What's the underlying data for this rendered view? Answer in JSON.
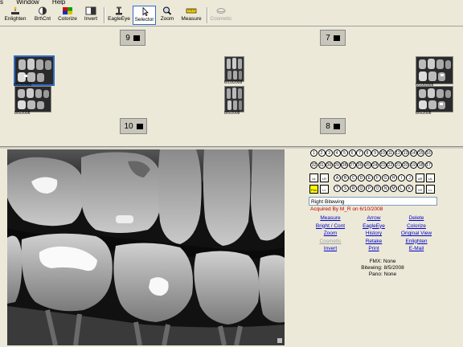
{
  "menubar": {
    "items": [
      "s",
      "Window",
      "Help"
    ]
  },
  "toolbar": {
    "buttons": [
      {
        "label": "Enlighten",
        "icon": "enlighten-icon",
        "selected": false,
        "disabled": false
      },
      {
        "label": "Brt\\Cnt",
        "icon": "brightness-contrast-icon",
        "selected": false,
        "disabled": false
      },
      {
        "label": "Colorize",
        "icon": "colorize-icon",
        "selected": false,
        "disabled": false
      },
      {
        "label": "Invert",
        "icon": "invert-icon",
        "selected": false,
        "disabled": false
      },
      {
        "label": "EagleEye",
        "icon": "eagleeye-icon",
        "selected": false,
        "disabled": false
      },
      {
        "label": "Selector",
        "icon": "selector-arrow-icon",
        "selected": true,
        "disabled": false
      },
      {
        "label": "Zoom",
        "icon": "zoom-icon",
        "selected": false,
        "disabled": false
      },
      {
        "label": "Measure",
        "icon": "measure-icon",
        "selected": false,
        "disabled": false
      },
      {
        "label": "Cosmetic",
        "icon": "cosmetic-icon",
        "selected": false,
        "disabled": true
      }
    ]
  },
  "nav": {
    "top_left": "9",
    "top_right": "7",
    "bottom_left": "10",
    "bottom_right": "8"
  },
  "thumbnails": {
    "left_top_date": "6/10/2008",
    "left_bottom_date": "8/5/2008",
    "mid_top_date": "6/10/2008",
    "mid_bottom_date": "8/5/2008",
    "right_top_date": "6/10/2008",
    "right_bottom_date": "8/5/2008"
  },
  "tooth_chart": {
    "upper_row": [
      "1",
      "2",
      "3",
      "4",
      "5",
      "6",
      "7",
      "8",
      "9",
      "10",
      "11",
      "12",
      "13",
      "14",
      "15",
      "16"
    ],
    "lower_row": [
      "32",
      "31",
      "30",
      "29",
      "28",
      "27",
      "26",
      "25",
      "24",
      "23",
      "22",
      "21",
      "20",
      "19",
      "18",
      "17"
    ],
    "primary_upper": [
      "A",
      "B",
      "C",
      "D",
      "E",
      "F",
      "G",
      "H",
      "I",
      "J"
    ],
    "primary_lower": [
      "T",
      "S",
      "R",
      "Q",
      "P",
      "O",
      "N",
      "M",
      "L",
      "K"
    ],
    "left_boxes": [
      "UL",
      "LR",
      "Pan",
      "LL"
    ],
    "right_boxes": [
      "UR",
      "UL",
      "LR",
      "LL"
    ]
  },
  "image_type": "Right Bitewing",
  "acquired": "Acquired By M_R on 6/10/2008",
  "links": {
    "col1": [
      "Measure",
      "Bright / Cont",
      "Zoom",
      "Cosmetic",
      "Invert"
    ],
    "col2": [
      "Arrow",
      "EagleEye",
      "History",
      "Retake",
      "Print"
    ],
    "col3": [
      "Delete",
      "Colorize",
      "Original View",
      "Enlighten",
      "E-Mail"
    ]
  },
  "info": {
    "fmx": "FMX: None",
    "bitewing": "Bitewing: 8/5/2008",
    "pano": "Pano: None"
  },
  "colors": {
    "accent": "#316ac5",
    "link": "#0000cc",
    "acquired": "#c00000"
  }
}
